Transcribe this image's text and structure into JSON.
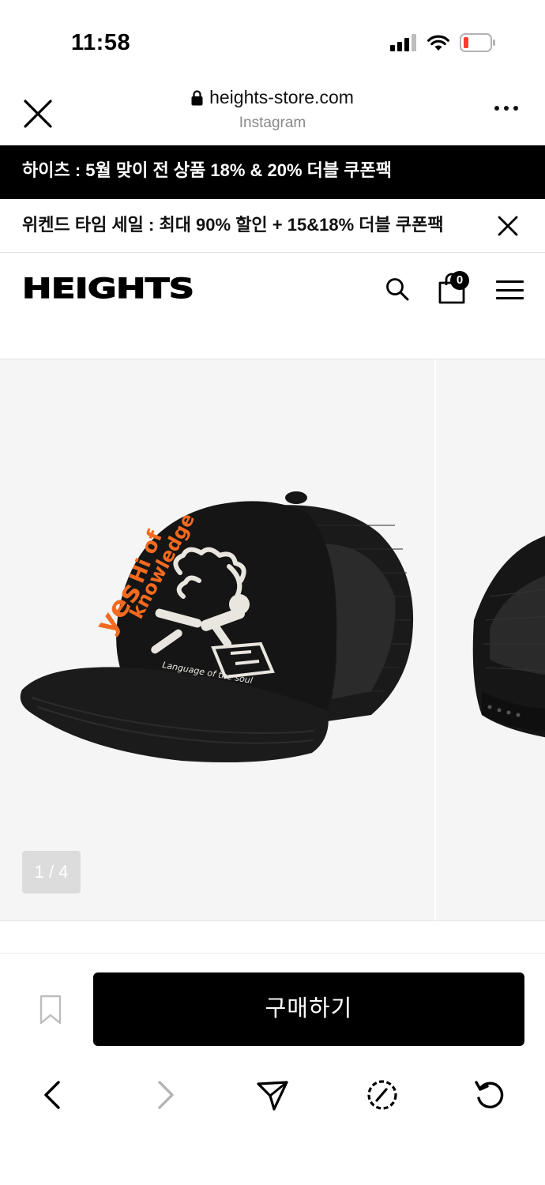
{
  "status_bar": {
    "time": "11:58"
  },
  "browser": {
    "url": "heights-store.com",
    "source": "Instagram"
  },
  "promos": {
    "banner1": "하이츠 : 5월 맞이 전 상품 18% & 20% 더블 쿠폰팩",
    "banner2": "위켄드 타임 세일 : 최대 90% 할인 + 15&18% 더블 쿠폰팩"
  },
  "header": {
    "logo": "HEIGHTS",
    "cart_count": "0"
  },
  "gallery": {
    "counter": "1 / 4",
    "cap_print_text": "Language of the soul"
  },
  "buy_bar": {
    "buy_label": "구매하기"
  },
  "colors": {
    "accent_orange": "#f26a1f",
    "cap_black": "#111111",
    "banner_black": "#000000"
  },
  "icons": {
    "status": [
      "signal-icon",
      "wifi-icon",
      "battery-low-icon"
    ],
    "browser": [
      "close-icon",
      "lock-icon",
      "more-icon"
    ],
    "header": [
      "search-icon",
      "cart-icon",
      "menu-icon"
    ],
    "toolbar": [
      "back-icon",
      "forward-icon",
      "share-icon",
      "compass-icon",
      "reload-icon"
    ]
  }
}
